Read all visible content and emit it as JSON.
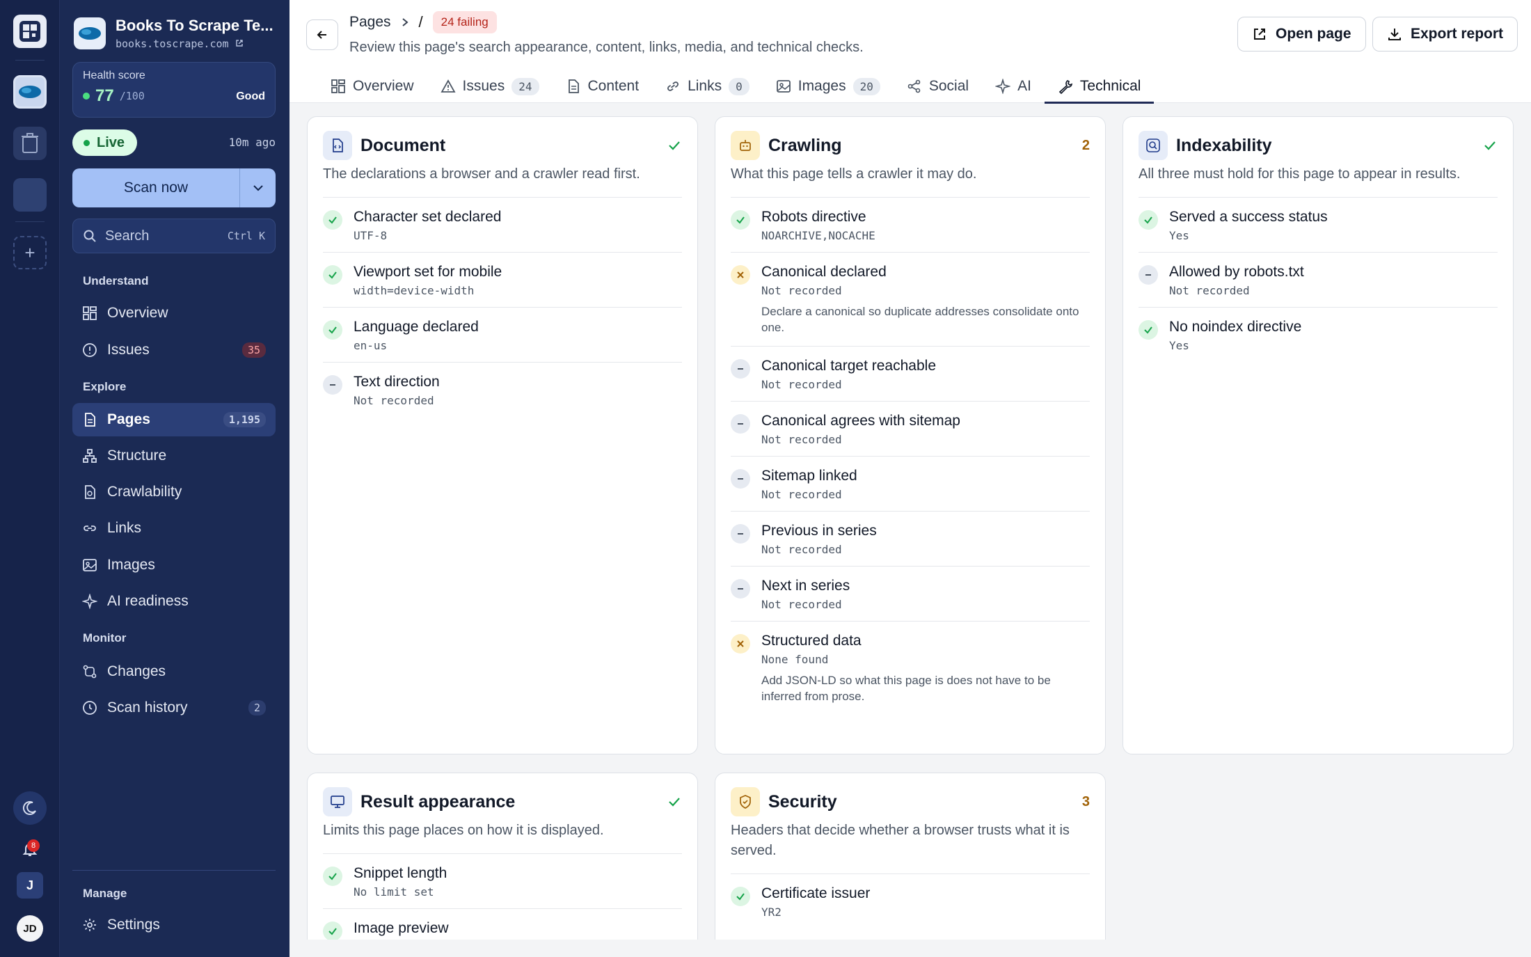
{
  "project": {
    "name": "Books To Scrape Te...",
    "url": "books.toscrape.com"
  },
  "health": {
    "label": "Health score",
    "score": "77",
    "max": "/100",
    "status": "Good"
  },
  "live": {
    "label": "Live",
    "ago": "10m ago"
  },
  "scan_button": "Scan now",
  "search": {
    "placeholder": "Search",
    "shortcut": "Ctrl K"
  },
  "nav": {
    "understand_label": "Understand",
    "explore_label": "Explore",
    "monitor_label": "Monitor",
    "manage_label": "Manage",
    "overview": "Overview",
    "issues": "Issues",
    "issues_count": "35",
    "pages": "Pages",
    "pages_count": "1,195",
    "structure": "Structure",
    "crawlability": "Crawlability",
    "links": "Links",
    "images": "Images",
    "ai_readiness": "AI readiness",
    "changes": "Changes",
    "scan_history": "Scan history",
    "scan_history_count": "2",
    "settings": "Settings"
  },
  "rail": {
    "notifications_count": "8",
    "user_initial": "J",
    "avatar_initials": "JD"
  },
  "header": {
    "crumb_pages": "Pages",
    "crumb_sep": "/",
    "failing_badge": "24 failing",
    "subtitle": "Review this page's search appearance, content, links, media, and technical checks.",
    "open_page": "Open page",
    "export_report": "Export report"
  },
  "tabs": {
    "overview": "Overview",
    "issues": "Issues",
    "issues_count": "24",
    "content": "Content",
    "links": "Links",
    "links_count": "0",
    "images": "Images",
    "images_count": "20",
    "social": "Social",
    "ai": "AI",
    "technical": "Technical"
  },
  "cards": {
    "document": {
      "title": "Document",
      "desc": "The declarations a browser and a crawler read first.",
      "checks": [
        {
          "name": "Character set declared",
          "value": "UTF-8"
        },
        {
          "name": "Viewport set for mobile",
          "value": "width=device-width"
        },
        {
          "name": "Language declared",
          "value": "en-us"
        },
        {
          "name": "Text direction",
          "value": "Not recorded"
        }
      ]
    },
    "crawling": {
      "title": "Crawling",
      "count": "2",
      "desc": "What this page tells a crawler it may do.",
      "checks": [
        {
          "name": "Robots directive",
          "value": "NOARCHIVE,NOCACHE"
        },
        {
          "name": "Canonical declared",
          "value": "Not recorded",
          "note": "Declare a canonical so duplicate addresses consolidate onto one."
        },
        {
          "name": "Canonical target reachable",
          "value": "Not recorded"
        },
        {
          "name": "Canonical agrees with sitemap",
          "value": "Not recorded"
        },
        {
          "name": "Sitemap linked",
          "value": "Not recorded"
        },
        {
          "name": "Previous in series",
          "value": "Not recorded"
        },
        {
          "name": "Next in series",
          "value": "Not recorded"
        },
        {
          "name": "Structured data",
          "value": "None found",
          "note": "Add JSON-LD so what this page is does not have to be inferred from prose."
        }
      ]
    },
    "indexability": {
      "title": "Indexability",
      "desc": "All three must hold for this page to appear in results.",
      "checks": [
        {
          "name": "Served a success status",
          "value": "Yes"
        },
        {
          "name": "Allowed by robots.txt",
          "value": "Not recorded"
        },
        {
          "name": "No noindex directive",
          "value": "Yes"
        }
      ]
    },
    "result_appearance": {
      "title": "Result appearance",
      "desc": "Limits this page places on how it is displayed.",
      "checks": [
        {
          "name": "Snippet length",
          "value": "No limit set"
        },
        {
          "name": "Image preview",
          "value": ""
        }
      ]
    },
    "security": {
      "title": "Security",
      "count": "3",
      "desc": "Headers that decide whether a browser trusts what it is served.",
      "checks": [
        {
          "name": "Certificate issuer",
          "value": "YR2"
        }
      ]
    }
  },
  "colors": {
    "sidebar_bg": "#1b2a54",
    "rail_bg": "#16234a",
    "ok": "#16a34a",
    "warn": "#a16207",
    "na": "#6b7280"
  }
}
